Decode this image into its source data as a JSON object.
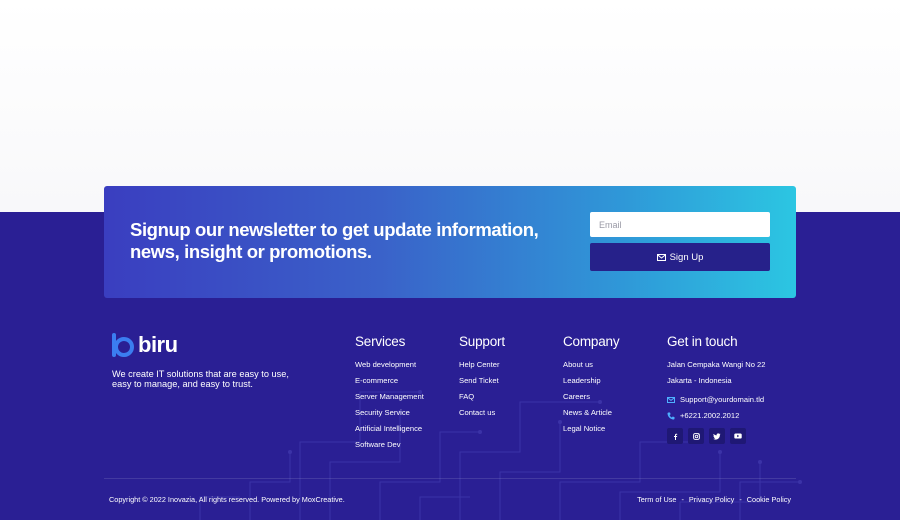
{
  "newsletter": {
    "title": "Signup our newsletter to get update information, news, insight or promotions.",
    "email_placeholder": "Email",
    "button_label": "Sign Up"
  },
  "brand": {
    "name": "biru",
    "tagline": "We create IT solutions that are easy to use, easy to manage, and easy to trust."
  },
  "services": {
    "heading": "Services",
    "items": [
      "Web development",
      "E-commerce",
      "Server Management",
      "Security Service",
      "Artificial Intelligence",
      "Software Dev"
    ]
  },
  "support": {
    "heading": "Support",
    "items": [
      "Help Center",
      "Send Ticket",
      "FAQ",
      "Contact us"
    ]
  },
  "company": {
    "heading": "Company",
    "items": [
      "About us",
      "Leadership",
      "Careers",
      "News & Article",
      "Legal Notice"
    ]
  },
  "contact": {
    "heading": "Get in touch",
    "address_line1": "Jalan Cempaka Wangi No 22",
    "address_line2": "Jakarta - Indonesia",
    "email": "Support@yourdomain.tld",
    "phone": "+6221.2002.2012",
    "socials": [
      "facebook-icon",
      "instagram-icon",
      "twitter-icon",
      "youtube-icon"
    ]
  },
  "bottom": {
    "copyright": "Copyright © 2022 Inovazia, All rights reserved. Powered by MoxCreative.",
    "links": [
      "Term of Use",
      "Privacy Policy",
      "Cookie Policy"
    ],
    "separator": "-"
  },
  "colors": {
    "footer_bg": "#2a1f94",
    "button_bg": "#26218a",
    "gradient_start": "#3a3ec0",
    "gradient_end": "#2cc6e2",
    "logo_accent": "#3b7df0"
  }
}
